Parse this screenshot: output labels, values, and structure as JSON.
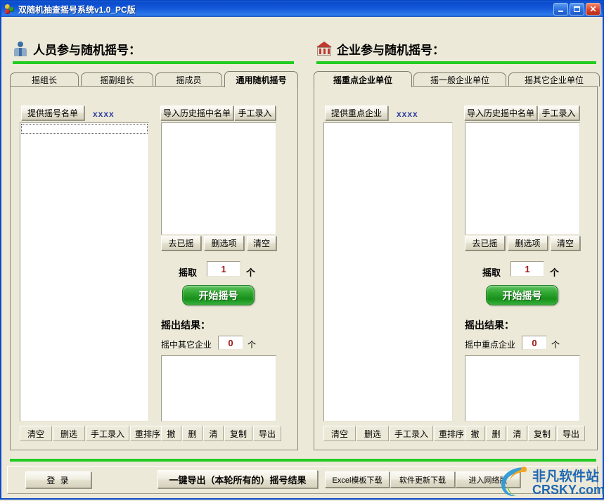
{
  "window": {
    "title": "双随机抽查摇号系统v1.0_PC版",
    "icon": "balls-icon",
    "controls": {
      "minimize": "minimize-button",
      "maximize": "maximize-button",
      "close": "close-button"
    }
  },
  "left_section": {
    "icon": "person-icon",
    "title": "人员参与随机摇号：",
    "tabs": [
      {
        "label": "摇组长",
        "active": false
      },
      {
        "label": "摇副组长",
        "active": false
      },
      {
        "label": "摇成员",
        "active": false
      },
      {
        "label": "通用随机摇号",
        "active": true
      }
    ],
    "source": {
      "provide_button": "提供摇号名单",
      "link_text": "xxxx",
      "list_value": ""
    },
    "history": {
      "import_button": "导入历史摇中名单",
      "manual_button": "手工录入",
      "list_value": "",
      "tools": [
        "去已摇",
        "删选项",
        "清空"
      ]
    },
    "draw": {
      "label": "摇取",
      "count": "1",
      "unit": "个",
      "start_button": "开始摇号"
    },
    "result": {
      "heading": "摇出结果：",
      "hit_label": "摇中其它企业",
      "hit_count": "0",
      "hit_unit": "个",
      "list_value": ""
    },
    "left_bottom_buttons": [
      "清空",
      "删选",
      "手工录入",
      "重排序"
    ],
    "right_bottom_buttons": [
      "撤",
      "删",
      "清",
      "复制",
      "导出"
    ]
  },
  "right_section": {
    "icon": "bank-icon",
    "title": "企业参与随机摇号：",
    "tabs": [
      {
        "label": "摇重点企业单位",
        "active": true
      },
      {
        "label": "摇一般企业单位",
        "active": false
      },
      {
        "label": "摇其它企业单位",
        "active": false
      }
    ],
    "source": {
      "provide_button": "提供重点企业",
      "link_text": "xxxx",
      "list_value": ""
    },
    "history": {
      "import_button": "导入历史摇中名单",
      "manual_button": "手工录入",
      "list_value": "",
      "tools": [
        "去已摇",
        "删选项",
        "清空"
      ]
    },
    "draw": {
      "label": "摇取",
      "count": "1",
      "unit": "个",
      "start_button": "开始摇号"
    },
    "result": {
      "heading": "摇出结果：",
      "hit_label": "摇中重点企业",
      "hit_count": "0",
      "hit_unit": "个",
      "list_value": ""
    },
    "left_bottom_buttons": [
      "清空",
      "删选",
      "手工录入",
      "重排序"
    ],
    "right_bottom_buttons": [
      "撤",
      "删",
      "清",
      "复制",
      "导出"
    ]
  },
  "bottom_bar": {
    "login_button": "登 录",
    "export_all_button": "一键导出（本轮所有的）摇号结果",
    "excel_template_button": "Excel模板下载",
    "software_update_button": "软件更新下载",
    "network_version_button": "进入网络版"
  },
  "watermark": {
    "line1": "非凡软件站",
    "line2": "CRSKY.com"
  },
  "colors": {
    "titlebar_blue": "#1559DA",
    "accent_green": "#22CC22",
    "button_green": "#2FA52F",
    "face": "#ECE9D8",
    "link_blue": "#2E3B9E",
    "number_red": "#A31515"
  }
}
